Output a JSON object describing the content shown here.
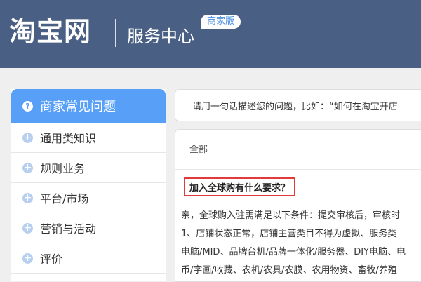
{
  "header": {
    "logo": "淘宝网",
    "service_title": "服务中心",
    "badge": "商家版"
  },
  "sidebar": {
    "title": "商家常见问题",
    "items": [
      {
        "label": "通用类知识"
      },
      {
        "label": "规则业务"
      },
      {
        "label": "平台/市场"
      },
      {
        "label": "营销与活动"
      },
      {
        "label": "评价"
      }
    ]
  },
  "search": {
    "placeholder": "请用一句话描述您的问题，比如：“如何在淘宝开店"
  },
  "content": {
    "tab": "全部",
    "question": "加入全球购有什么要求？",
    "answer_lines": [
      "亲，全球购入驻需满足以下条件：提交审核后，审核时",
      "1、店铺状态正常，店铺主营类目不得为虚拟、服务类",
      "电脑/MID、品牌台机/品牌一体化/服务器、DIY电脑、电",
      "币/字画/收藏、农机/农具/农膜、农用物资、畜牧/养殖"
    ]
  },
  "colors": {
    "header_bg": "#4a5f84",
    "accent": "#58a0f7",
    "highlight_border": "#e23a3a"
  }
}
